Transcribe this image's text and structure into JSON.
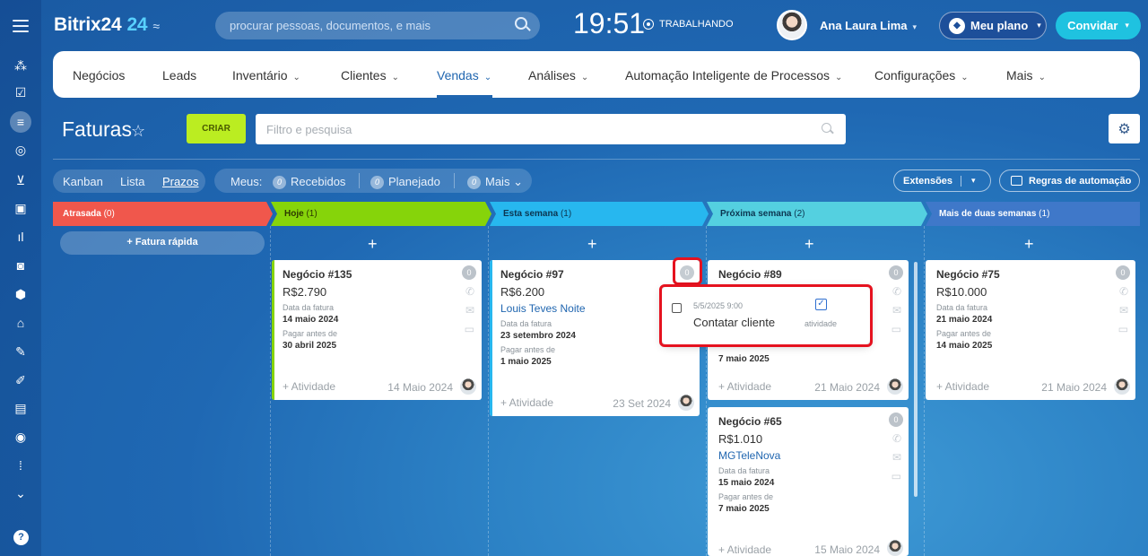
{
  "header": {
    "logo": "Bitrix24",
    "logo_num": "24",
    "logo_switch": "≈",
    "search_placeholder": "procurar pessoas, documentos, e mais",
    "clock": "19:51",
    "work_status": "TRABALHANDO",
    "user": "Ana Laura Lima",
    "plan": "Meu plano",
    "invite": "Convidar"
  },
  "leftbar": {
    "icons": [
      "menu-icon",
      "flow-icon",
      "checkbox-icon",
      "filter-icon",
      "target-icon",
      "cart-icon",
      "contact-card-icon",
      "bar-chart-icon",
      "robot-icon",
      "box-icon",
      "bank-icon",
      "sign-icon",
      "document-edit-icon",
      "calendar-icon",
      "circle-icon",
      "dots-icon",
      "chevron-circle-icon",
      "help-icon"
    ]
  },
  "nav": {
    "items": [
      {
        "label": "Negócios",
        "caret": false
      },
      {
        "label": "Leads",
        "caret": false
      },
      {
        "label": "Inventário",
        "caret": true
      },
      {
        "label": "Clientes",
        "caret": true
      },
      {
        "label": "Vendas",
        "caret": true,
        "active": true
      },
      {
        "label": "Análises",
        "caret": true
      },
      {
        "label": "Automação Inteligente de Processos",
        "caret": true
      },
      {
        "label": "Configurações",
        "caret": true
      },
      {
        "label": "Mais",
        "caret": true
      }
    ]
  },
  "page": {
    "title": "Faturas",
    "create": "CRIAR",
    "filter_placeholder": "Filtro e pesquisa"
  },
  "views": {
    "kanban": "Kanban",
    "lista": "Lista",
    "prazos": "Prazos"
  },
  "meus": {
    "label": "Meus:",
    "recebidos": "Recebidos",
    "recebidos_count": "0",
    "planejado": "Planejado",
    "planejado_count": "0",
    "mais": "Mais",
    "mais_count": "0"
  },
  "toolbar": {
    "extensoes": "Extensões",
    "regras": "Regras de automação"
  },
  "columns": [
    {
      "name": "Atrasada",
      "count": "(0)",
      "color": "#f0574c"
    },
    {
      "name": "Hoje",
      "count": "(1)",
      "color": "#86d40a"
    },
    {
      "name": "Esta semana",
      "count": "(1)",
      "color": "#27b7ef"
    },
    {
      "name": "Próxima semana",
      "count": "(2)",
      "color": "#54d0e0"
    },
    {
      "name": "Mais de duas semanas",
      "count": "(1)",
      "color": "#3f78c9"
    }
  ],
  "fatura_rapida": "+ Fatura rápida",
  "labels": {
    "data_fatura": "Data da fatura",
    "pagar_antes": "Pagar antes de",
    "atividade": "+ Atividade"
  },
  "cards": {
    "c135": {
      "title": "Negócio #135",
      "amount": "R$2.790",
      "data_fatura": "14 maio 2024",
      "pagar": "30 abril 2025",
      "date": "14 Maio 2024",
      "badge": "0"
    },
    "c97": {
      "title": "Negócio #97",
      "amount": "R$6.200",
      "client": "Louis Teves Noite",
      "data_fatura": "23 setembro 2024",
      "pagar": "1 maio 2025",
      "date": "23 Set 2024",
      "badge": "0"
    },
    "c89": {
      "title": "Negócio #89",
      "pagar": "7 maio 2025",
      "date": "21 Maio 2024",
      "badge": "0"
    },
    "c65": {
      "title": "Negócio #65",
      "amount": "R$1.010",
      "client": "MGTeleNova",
      "data_fatura": "15 maio 2024",
      "pagar": "7 maio 2025",
      "date": "15 Maio 2024",
      "badge": "0"
    },
    "c75": {
      "title": "Negócio #75",
      "amount": "R$10.000",
      "data_fatura": "21 maio 2024",
      "pagar": "14 maio 2025",
      "date": "21 Maio 2024",
      "badge": "0"
    }
  },
  "popup": {
    "datetime": "5/5/2025 9:00",
    "text": "Contatar cliente",
    "type": "atividade"
  }
}
